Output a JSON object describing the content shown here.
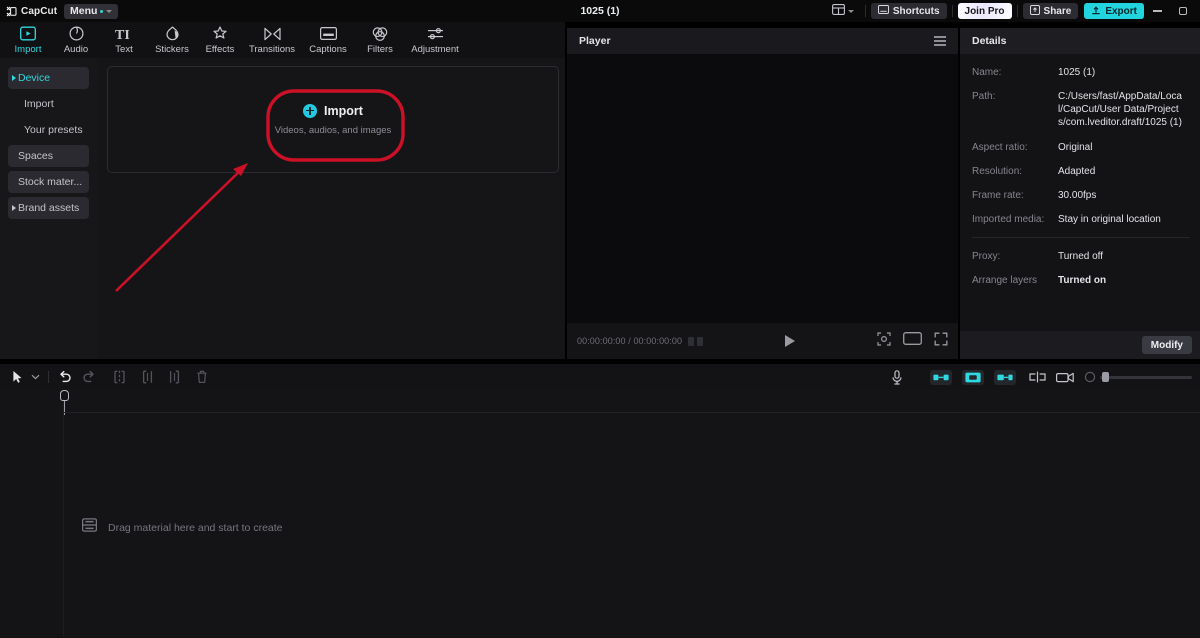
{
  "titlebar": {
    "app_name": "CapCut",
    "menu_label": "Menu",
    "project_title": "1025 (1)",
    "shortcuts_label": "Shortcuts",
    "join_pro_label": "Join Pro",
    "share_label": "Share",
    "export_label": "Export",
    "layout_icon": "layout-switch-icon",
    "minimize_icon": "minimize-icon",
    "maximize_icon": "maximize-icon"
  },
  "nav": {
    "tabs": [
      {
        "label": "Import",
        "icon": "import-icon",
        "active": true
      },
      {
        "label": "Audio",
        "icon": "audio-note-icon",
        "active": false
      },
      {
        "label": "Text",
        "icon": "text-ti-icon",
        "active": false
      },
      {
        "label": "Stickers",
        "icon": "sticker-icon",
        "active": false
      },
      {
        "label": "Effects",
        "icon": "effects-sparkle-icon",
        "active": false
      },
      {
        "label": "Transitions",
        "icon": "transitions-icon",
        "active": false
      },
      {
        "label": "Captions",
        "icon": "captions-icon",
        "active": false
      },
      {
        "label": "Filters",
        "icon": "filters-rings-icon",
        "active": false
      },
      {
        "label": "Adjustment",
        "icon": "adjustment-sliders-icon",
        "active": false
      }
    ]
  },
  "sidebar": {
    "items": [
      {
        "label": "Device",
        "active": true,
        "filled": true,
        "arrow": true,
        "sub": false
      },
      {
        "label": "Import",
        "active": false,
        "filled": false,
        "arrow": false,
        "sub": true
      },
      {
        "label": "Your presets",
        "active": false,
        "filled": false,
        "arrow": false,
        "sub": true
      },
      {
        "label": "Spaces",
        "active": false,
        "filled": true,
        "arrow": false,
        "sub": false
      },
      {
        "label": "Stock mater...",
        "active": false,
        "filled": true,
        "arrow": false,
        "sub": false
      },
      {
        "label": "Brand assets",
        "active": false,
        "filled": true,
        "arrow": true,
        "sub": false
      }
    ]
  },
  "media": {
    "import_title": "Import",
    "import_subtitle": "Videos, audios, and images",
    "plus_icon": "plus-circle-icon"
  },
  "player": {
    "title": "Player",
    "menu_icon": "hamburger-menu-icon",
    "current_time": "00:00:00:00",
    "total_time": "00:00:00:00",
    "timecode": "00:00:00:00 / 00:00:00:00",
    "play_icon": "play-icon",
    "crop_icon": "crop-marker-icon",
    "ratio_icon": "aspect-ratio-icon",
    "fullscreen_icon": "fullscreen-icon"
  },
  "details": {
    "title": "Details",
    "modify_label": "Modify",
    "rows": [
      {
        "key": "Name:",
        "value": "1025 (1)",
        "bold": false
      },
      {
        "key": "Path:",
        "value": "C:/Users/fast/AppData/Local/CapCut/User Data/Projects/com.lveditor.draft/1025 (1)",
        "bold": false
      },
      {
        "key": "Aspect ratio:",
        "value": "Original",
        "bold": false
      },
      {
        "key": "Resolution:",
        "value": "Adapted",
        "bold": false
      },
      {
        "key": "Frame rate:",
        "value": "30.00fps",
        "bold": false
      },
      {
        "key": "Imported media:",
        "value": "Stay in original location",
        "bold": false
      }
    ],
    "rows2": [
      {
        "key": "Proxy:",
        "value": "Turned off",
        "bold": false
      },
      {
        "key": "Arrange layers",
        "value": "Turned on",
        "bold": true
      }
    ]
  },
  "timeline": {
    "toolbar": {
      "select_icon": "cursor-select-icon",
      "select_caret_icon": "chevron-down-icon",
      "undo_icon": "undo-icon",
      "redo_icon": "redo-icon",
      "split_icon": "split-icon",
      "trim_left_icon": "trim-left-icon",
      "trim_right_icon": "trim-right-icon",
      "delete_icon": "delete-icon",
      "record_icon": "microphone-record-icon",
      "auto_velocity_icon": "auto-velocity-icon",
      "adsorption_icon": "adsorption-magnet-icon",
      "auto_fill_icon": "auto-fill-icon",
      "mirror_icon": "mirror-icon",
      "preview_icon": "preview-toggle-icon",
      "zoom_fit_icon": "zoom-fit-icon"
    },
    "ruler_start": "0",
    "empty_label": "Drag material here and start to create",
    "empty_icon": "media-track-icon"
  },
  "annotations": {
    "highlight_shape": "red-rounded-rect",
    "arrow": "red-arrow",
    "color": "#cc1126"
  },
  "colors": {
    "accent_teal": "#2fd8e0",
    "export_bg": "#21d4dd",
    "annotation_red": "#cc1126",
    "panel_bg": "#151518",
    "titlebar_bg": "#0a0a0b"
  }
}
